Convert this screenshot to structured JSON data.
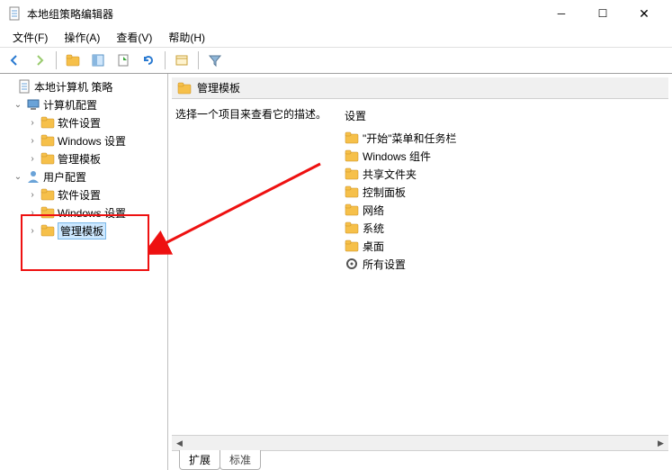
{
  "titlebar": {
    "title": "本地组策略编辑器"
  },
  "menubar": {
    "file": "文件(F)",
    "action": "操作(A)",
    "view": "查看(V)",
    "help": "帮助(H)"
  },
  "tree": {
    "root": "本地计算机 策略",
    "computer": {
      "label": "计算机配置",
      "software": "软件设置",
      "windows": "Windows 设置",
      "admin": "管理模板"
    },
    "user": {
      "label": "用户配置",
      "software": "软件设置",
      "windows": "Windows 设置",
      "admin": "管理模板"
    }
  },
  "header": {
    "folder": "管理模板"
  },
  "desc": {
    "text": "选择一个项目来查看它的描述。"
  },
  "list": {
    "header": "设置",
    "items": [
      "\"开始\"菜单和任务栏",
      "Windows 组件",
      "共享文件夹",
      "控制面板",
      "网络",
      "系统",
      "桌面",
      "所有设置"
    ]
  },
  "tabs": {
    "extended": "扩展",
    "standard": "标准"
  }
}
